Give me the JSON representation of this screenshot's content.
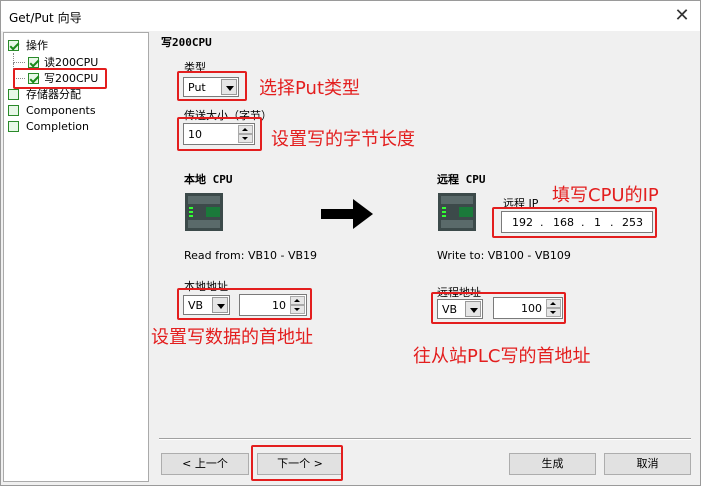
{
  "window": {
    "title": "Get/Put 向导",
    "close": "✕"
  },
  "tree": {
    "items": [
      {
        "label": "操作"
      },
      {
        "label": "读200CPU"
      },
      {
        "label": "写200CPU"
      },
      {
        "label": "存储器分配"
      },
      {
        "label": "Components"
      },
      {
        "label": "Completion"
      }
    ]
  },
  "section_title": "写200CPU",
  "type": {
    "label": "类型",
    "value": "Put"
  },
  "size": {
    "label": "传送大小（字节）",
    "value": "10"
  },
  "local": {
    "title": "本地 CPU",
    "read_from": "Read from: VB10 - VB19",
    "addr_label": "本地地址",
    "area": "VB",
    "offset": "10"
  },
  "remote": {
    "title": "远程 CPU",
    "ip_label": "远程 IP",
    "ip": [
      "192",
      "168",
      "1",
      "253"
    ],
    "write_to": "Write to: VB100 - VB109",
    "addr_label": "远程地址",
    "area": "VB",
    "offset": "100"
  },
  "annotations": {
    "type": "选择Put类型",
    "size": "设置写的字节长度",
    "ip": "填写CPU的IP",
    "local_addr": "设置写数据的首地址",
    "remote_addr": "往从站PLC写的首地址"
  },
  "buttons": {
    "prev": "< 上一个",
    "next": "下一个 >",
    "finish": "生成",
    "cancel": "取消"
  },
  "colors": {
    "annotation": "#e31e1e",
    "check": "#1a8a1a"
  }
}
